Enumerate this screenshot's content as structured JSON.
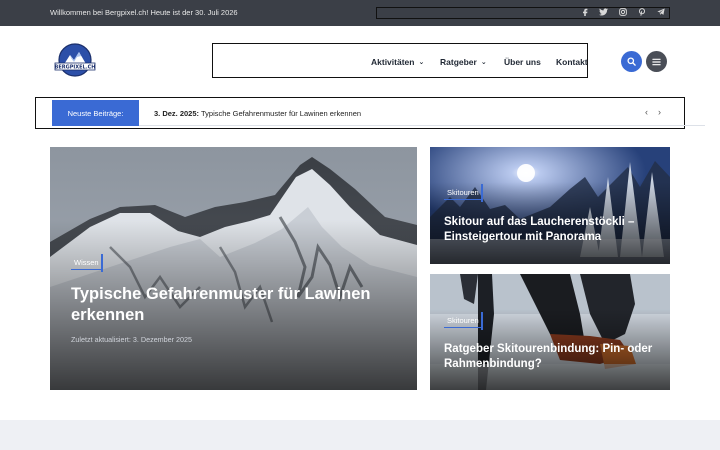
{
  "topbar": {
    "welcome": "Willkommen bei Bergpixel.ch! Heute ist der 30. Juli 2026",
    "social": [
      "facebook-icon",
      "twitter-icon",
      "instagram-icon",
      "pinterest-icon",
      "telegram-icon"
    ]
  },
  "header": {
    "logo_text": "BERGPIXEL.CH",
    "nav": [
      {
        "label": "Aktivitäten",
        "has_dropdown": true
      },
      {
        "label": "Ratgeber",
        "has_dropdown": true
      },
      {
        "label": "Über uns",
        "has_dropdown": false
      },
      {
        "label": "Kontakt",
        "has_dropdown": false
      }
    ]
  },
  "ticker": {
    "label": "Neuste Beiträge:",
    "date": "3. Dez. 2025:",
    "title": "Typische Gefahrenmuster für Lawinen erkennen"
  },
  "cards": {
    "main": {
      "category": "Wissen",
      "title": "Typische Gefahrenmuster für Lawinen erkennen",
      "meta": "Zuletzt aktualisiert: 3. Dezember 2025"
    },
    "top": {
      "category": "Skitouren",
      "title": "Skitour auf das Laucherenstöckli – Einsteigertour mit Panorama"
    },
    "bottom": {
      "category": "Skitouren",
      "title": "Ratgeber Skitourenbindung: Pin- oder Rahmenbindung?"
    }
  },
  "colors": {
    "accent": "#3a6ad4",
    "topbar": "#3b3f47",
    "menu_button": "#4a4e57"
  }
}
